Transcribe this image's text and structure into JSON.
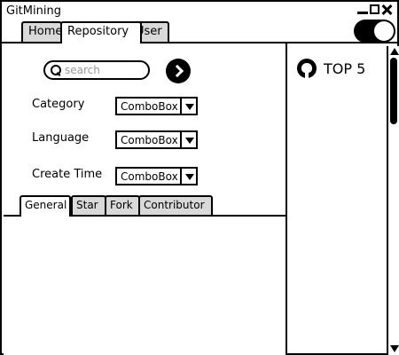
{
  "window": {
    "title": "GitMining"
  },
  "tabs": {
    "home": "Home",
    "repository": "Repository",
    "user": "User",
    "active": "Repository"
  },
  "search": {
    "placeholder": "search"
  },
  "filters": {
    "category": {
      "label": "Category",
      "value": "ComboBox"
    },
    "language": {
      "label": "Language",
      "value": "ComboBox"
    },
    "create_time": {
      "label": "Create Time",
      "value": "ComboBox"
    }
  },
  "subtabs": {
    "general": "General",
    "star": "Star",
    "fork": "Fork",
    "contributor": "Contributor",
    "active": "General"
  },
  "sidebar": {
    "title": "TOP 5",
    "icon": "github-icon"
  },
  "toggle": {
    "state": "on"
  }
}
